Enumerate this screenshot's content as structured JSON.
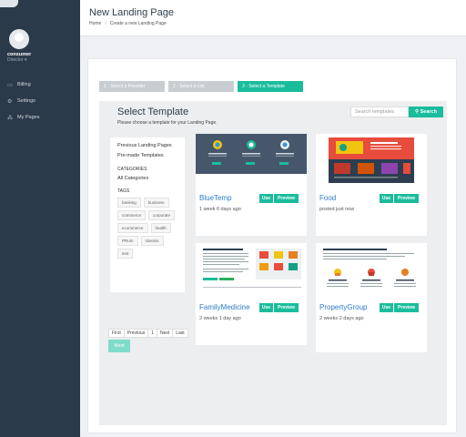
{
  "sidebar": {
    "user_name": "consumer",
    "user_role": "Director ▾",
    "items": [
      {
        "label": "Billing",
        "icon": "credit-card-icon"
      },
      {
        "label": "Settings",
        "icon": "gear-icon"
      },
      {
        "label": "My Pages",
        "icon": "sitemap-icon"
      }
    ]
  },
  "header": {
    "title": "New Landing Page",
    "breadcrumb": [
      "Home",
      "Create a new Landing Page"
    ]
  },
  "steps": [
    {
      "label": "1 - Select a Provider"
    },
    {
      "label": "2 - Select a List"
    },
    {
      "label": "3 - Select a Template"
    }
  ],
  "templates_panel": {
    "title": "Select Template",
    "subtitle": "Please choose a template for your Landing Page.",
    "search_placeholder": "Search templates",
    "search_label": "Search"
  },
  "filters": {
    "links": [
      "Previous Landing Pages",
      "Pre-made Templates"
    ],
    "categories_heading": "CATEGORIES",
    "category_all": "All Categories",
    "tags_heading": "TAGS",
    "tags": [
      "banking",
      "business",
      "commerce",
      "corporate",
      "ecommerce",
      "health",
      "PRum",
      "stassss",
      "test"
    ]
  },
  "templates": [
    {
      "name": "BlueTemp",
      "date": "1 week 6 days ago"
    },
    {
      "name": "Food",
      "date": "posted just now"
    },
    {
      "name": "FamilyMedicine",
      "date": "2 weeks 1 day ago"
    },
    {
      "name": "PropertyGroup",
      "date": "2 weeks 2 days ago"
    }
  ],
  "template_actions": {
    "use": "Use",
    "preview": "Preview"
  },
  "pagination": [
    "First",
    "Previous",
    "1",
    "Next",
    "Last"
  ],
  "next_button": "Next",
  "colors": {
    "accent": "#1abc9c",
    "sidebar": "#2b3a4a",
    "link": "#2a7cc7"
  }
}
